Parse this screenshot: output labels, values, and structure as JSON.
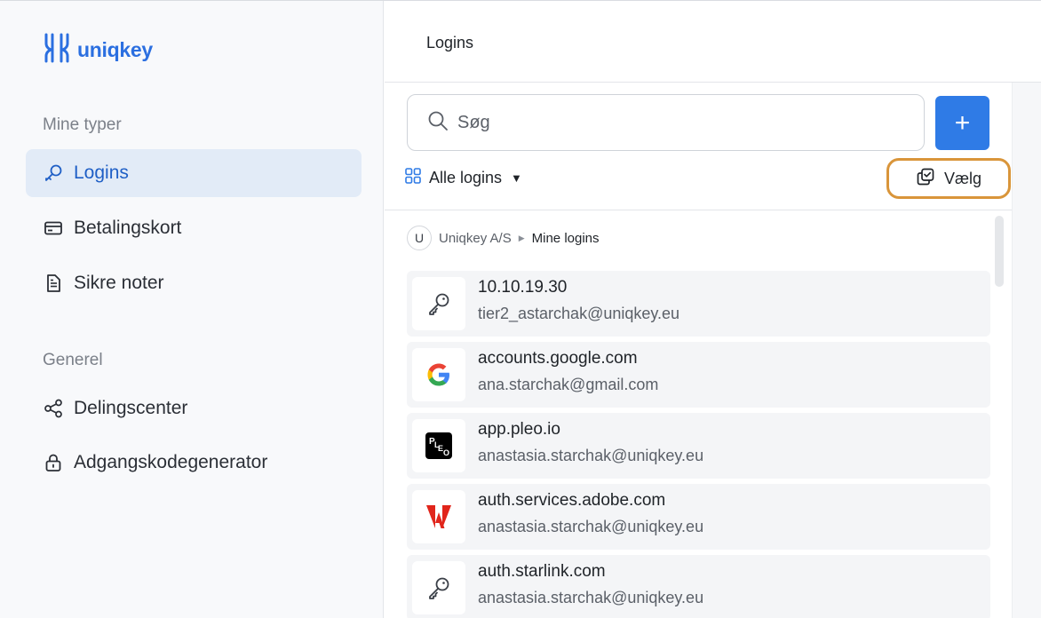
{
  "brand": {
    "name": "uniqkey",
    "accent": "#2f7be6"
  },
  "sidebar": {
    "sections": [
      {
        "label": "Mine typer"
      },
      {
        "label": "Generel"
      }
    ],
    "items": [
      {
        "label": "Logins",
        "icon": "key-icon",
        "active": true
      },
      {
        "label": "Betalingskort",
        "icon": "credit-card-icon"
      },
      {
        "label": "Sikre noter",
        "icon": "document-icon"
      },
      {
        "label": "Delingscenter",
        "icon": "share-icon"
      },
      {
        "label": "Adgangskodegenerator",
        "icon": "lock-icon"
      }
    ]
  },
  "header": {
    "title": "Logins"
  },
  "search": {
    "placeholder": "Søg",
    "add_label": "+"
  },
  "filter": {
    "label": "Alle logins",
    "select_label": "Vælg"
  },
  "breadcrumb": {
    "avatar": "U",
    "org": "Uniqkey A/S",
    "current": "Mine logins"
  },
  "logins": [
    {
      "site": "10.10.19.30",
      "user": "tier2_astarchak@uniqkey.eu",
      "icon": "key-icon"
    },
    {
      "site": "accounts.google.com",
      "user": "ana.starchak@gmail.com",
      "icon": "google-icon"
    },
    {
      "site": "app.pleo.io",
      "user": "anastasia.starchak@uniqkey.eu",
      "icon": "pleo-icon"
    },
    {
      "site": "auth.services.adobe.com",
      "user": "anastasia.starchak@uniqkey.eu",
      "icon": "adobe-icon"
    },
    {
      "site": "auth.starlink.com",
      "user": "anastasia.starchak@uniqkey.eu",
      "icon": "key-icon"
    }
  ]
}
